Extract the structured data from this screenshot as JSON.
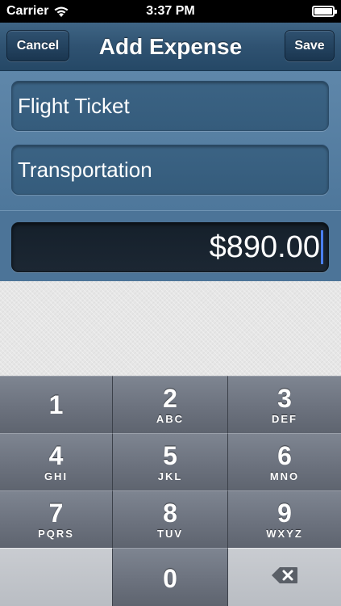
{
  "status_bar": {
    "carrier": "Carrier",
    "time": "3:37 PM"
  },
  "nav": {
    "title": "Add Expense",
    "cancel_label": "Cancel",
    "save_label": "Save"
  },
  "form": {
    "name_value": "Flight Ticket",
    "category_value": "Transportation",
    "amount_value": "$890.00"
  },
  "keypad": {
    "keys": [
      {
        "digit": "1",
        "letters": ""
      },
      {
        "digit": "2",
        "letters": "ABC"
      },
      {
        "digit": "3",
        "letters": "DEF"
      },
      {
        "digit": "4",
        "letters": "GHI"
      },
      {
        "digit": "5",
        "letters": "JKL"
      },
      {
        "digit": "6",
        "letters": "MNO"
      },
      {
        "digit": "7",
        "letters": "PQRS"
      },
      {
        "digit": "8",
        "letters": "TUV"
      },
      {
        "digit": "9",
        "letters": "WXYZ"
      },
      {
        "digit": "0",
        "letters": ""
      }
    ]
  },
  "colors": {
    "nav_bar": "#2f5271",
    "form_background": "#5a82a5",
    "keypad_key": "#6c727e",
    "cursor": "#4a7ff0"
  }
}
